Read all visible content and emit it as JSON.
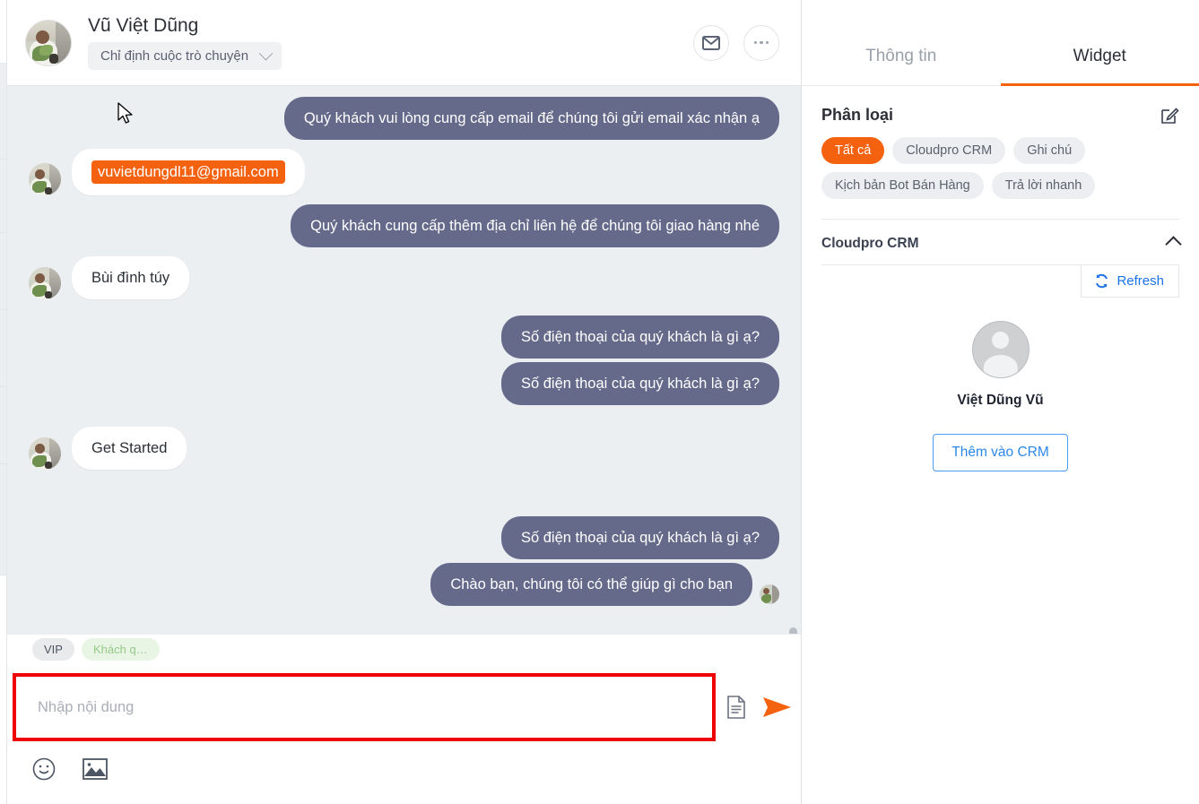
{
  "chat_header": {
    "contact_name": "Vũ Việt Dũng",
    "assign_label": "Chỉ định cuộc trò chuyện",
    "mail_icon": "envelope-icon",
    "more_icon": "more-horizontal-icon",
    "avatar": "contact-avatar"
  },
  "messages": [
    {
      "id": 1,
      "dir": "out",
      "text": "Quý khách vui lòng cung cấp email để chúng tôi gửi email xác nhận ạ"
    },
    {
      "id": 2,
      "dir": "in",
      "text": "vuvietdungdl11@gmail.com",
      "highlight": true
    },
    {
      "id": 3,
      "dir": "out",
      "text": "Quý khách cung cấp thêm địa chỉ liên hệ để chúng tôi giao hàng nhé"
    },
    {
      "id": 4,
      "dir": "in",
      "text": "Bùi đình túy"
    },
    {
      "id": 5,
      "dir": "out",
      "text": "Số điện thoại của quý khách là gì ạ?"
    },
    {
      "id": 6,
      "dir": "out",
      "text": "Số điện thoại của quý khách là gì ạ?"
    },
    {
      "id": 7,
      "dir": "in",
      "text": "Get Started"
    },
    {
      "id": 8,
      "dir": "out",
      "text": "Số điện thoại của quý khách là gì ạ?"
    },
    {
      "id": 9,
      "dir": "out",
      "text": "Chào bạn, chúng tôi có thể giúp gì cho bạn",
      "read": true
    }
  ],
  "tags": [
    {
      "label": "VIP",
      "style": "vip"
    },
    {
      "label": "Khách q…",
      "style": "guest"
    }
  ],
  "composer": {
    "placeholder": "Nhập nội dung",
    "value": "",
    "attach_icon": "document-icon",
    "send_icon": "send-icon",
    "emoji_icon": "emoji-icon",
    "image_icon": "image-icon"
  },
  "right_panel": {
    "tabs": [
      {
        "label": "Thông tin",
        "active": false
      },
      {
        "label": "Widget",
        "active": true
      }
    ],
    "section": {
      "title": "Phân loại",
      "edit_icon": "edit-pencil-icon"
    },
    "chips": [
      {
        "label": "Tất cả",
        "active": true
      },
      {
        "label": "Cloudpro CRM",
        "active": false
      },
      {
        "label": "Ghi chú",
        "active": false
      },
      {
        "label": "Kịch bản Bot Bán Hàng",
        "active": false
      },
      {
        "label": "Trả lời nhanh",
        "active": false
      }
    ],
    "crm": {
      "title": "Cloudpro CRM",
      "collapse_icon": "chevron-up-icon",
      "refresh_label": "Refresh",
      "refresh_icon": "refresh-icon",
      "contact_name": "Việt Dũng Vũ",
      "add_button": "Thêm vào CRM",
      "avatar_icon": "user-placeholder-icon"
    }
  },
  "colors": {
    "accent_orange": "#f4620f",
    "bubble_out": "#656a8a",
    "bubble_in": "#ffffff",
    "chat_bg": "#eceff1",
    "link_blue": "#2b88e8",
    "highlight_border": "#ee0000"
  }
}
